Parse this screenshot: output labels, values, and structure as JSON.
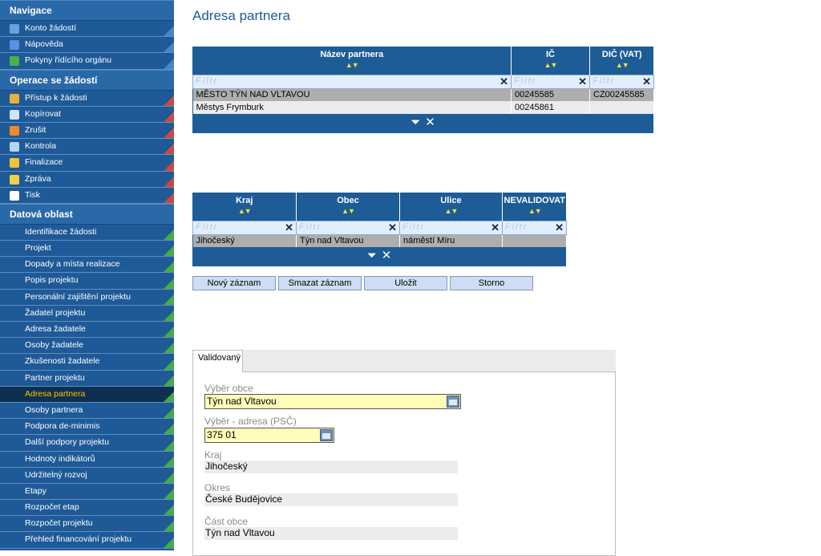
{
  "sidebar": {
    "nav_title": "Navigace",
    "nav_items": [
      {
        "label": "Konto žádostí",
        "icon": "list-icon",
        "color": "#6aa0e0"
      },
      {
        "label": "Nápověda",
        "icon": "help-icon",
        "color": "#5b8fe0"
      },
      {
        "label": "Pokyny řídícího orgánu",
        "icon": "info-icon",
        "color": "#47b34a"
      }
    ],
    "ops_title": "Operace se žádostí",
    "ops_items": [
      {
        "label": "Přístup k žádosti",
        "icon": "users-icon",
        "color": "#e8b13a"
      },
      {
        "label": "Kopírovat",
        "icon": "copy-arrow-icon",
        "color": "#cfe3ff"
      },
      {
        "label": "Zrušit",
        "icon": "cancel-icon",
        "color": "#f08a2a"
      },
      {
        "label": "Kontrola",
        "icon": "check-icon",
        "color": "#b9d4f0"
      },
      {
        "label": "Finalizace",
        "icon": "lock-icon",
        "color": "#f2c23a"
      },
      {
        "label": "Zpráva",
        "icon": "message-icon",
        "color": "#f2d04a"
      },
      {
        "label": "Tisk",
        "icon": "print-icon",
        "color": "#ffffff"
      }
    ],
    "data_title": "Datová oblast",
    "data_items": [
      "Identifikace žádosti",
      "Projekt",
      "Dopady a místa realizace",
      "Popis projektu",
      "Personální zajištění projektu",
      "Žadatel projektu",
      "Adresa žadatele",
      "Osoby žadatele",
      "Zkušenosti žadatele",
      "Partner projektu",
      "Adresa partnera",
      "Osoby partnera",
      "Podpora de-minimis",
      "Další podpory projektu",
      "Hodnoty indikátorů",
      "Udržitelný rozvoj",
      "Etapy",
      "Rozpočet etap",
      "Rozpočet projektu",
      "Přehled financování projektu"
    ],
    "active_item": "Adresa partnera"
  },
  "main": {
    "title": "Adresa partnera",
    "grid1": {
      "headers": [
        "Název partnera",
        "IČ",
        "DIČ (VAT)"
      ],
      "filter_placeholder": "Filtr",
      "rows": [
        [
          "MĚSTO TÝN NAD VLTAVOU",
          "00245585",
          "CZ00245585"
        ],
        [
          "Městys Frymburk",
          "00245861",
          ""
        ]
      ]
    },
    "grid2": {
      "headers": [
        "Kraj",
        "Obec",
        "Ulice",
        "NEVALIDOVAT"
      ],
      "filter_placeholder": "Filtr",
      "rows": [
        [
          "Jihočeský",
          "Týn nad Vltavou",
          "náměstí Míru",
          ""
        ]
      ]
    },
    "buttons": [
      "Nový záznam",
      "Smazat záznam",
      "Uložit",
      "Storno"
    ],
    "tab_label": "Validovaný",
    "form": {
      "vyber_obce_label": "Výběr obce",
      "vyber_obce_value": "Týn nad Vltavou",
      "vyber_adresa_label": "Výběr - adresa (PSČ)",
      "vyber_adresa_value": "375 01",
      "kraj_label": "Kraj",
      "kraj_value": "Jihočeský",
      "okres_label": "Okres",
      "okres_value": "České Budějovice",
      "cast_obce_label": "Část obce",
      "cast_obce_value": "Týn nad Vltavou"
    }
  }
}
